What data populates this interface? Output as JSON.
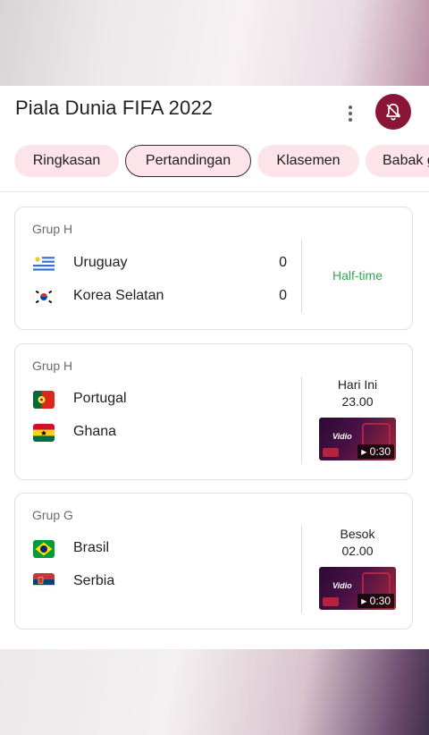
{
  "header": {
    "title": "Piala Dunia FIFA 2022"
  },
  "tabs": [
    {
      "label": "Ringkasan",
      "active": false
    },
    {
      "label": "Pertandingan",
      "active": true
    },
    {
      "label": "Klasemen",
      "active": false
    },
    {
      "label": "Babak gugur",
      "active": false
    }
  ],
  "matches": [
    {
      "group": "Grup H",
      "home": {
        "name": "Uruguay",
        "score": "0",
        "flag": "uruguay-flag"
      },
      "away": {
        "name": "Korea Selatan",
        "score": "0",
        "flag": "south-korea-flag"
      },
      "status": "Half-time"
    },
    {
      "group": "Grup H",
      "home": {
        "name": "Portugal",
        "flag": "portugal-flag"
      },
      "away": {
        "name": "Ghana",
        "flag": "ghana-flag"
      },
      "day": "Hari Ini",
      "time": "23.00",
      "video": {
        "brand": "Vidio",
        "duration": "0:30"
      }
    },
    {
      "group": "Grup G",
      "home": {
        "name": "Brasil",
        "flag": "brazil-flag"
      },
      "away": {
        "name": "Serbia",
        "flag": "serbia-flag"
      },
      "day": "Besok",
      "time": "02.00",
      "video": {
        "brand": "Vidio",
        "duration": "0:30"
      }
    }
  ],
  "colors": {
    "accent": "#8b1538",
    "tab_bg": "#fce4ea",
    "status_green": "#34a853"
  }
}
